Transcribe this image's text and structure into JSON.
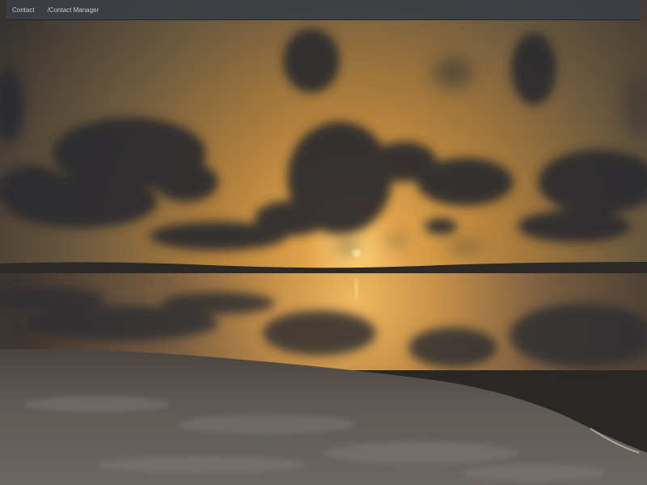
{
  "navbar": {
    "brand_label": "Contact",
    "link_label": "/Contact Manager"
  },
  "background": {
    "scene": "sunset-lake-photo",
    "colors": {
      "sky_top": "#3a3632",
      "sky_glow": "#c98f3c",
      "horizon": "#e8a850",
      "cloud": "#2b2a2c",
      "water": "#8a6a3a",
      "shore": "#5a5650"
    }
  }
}
